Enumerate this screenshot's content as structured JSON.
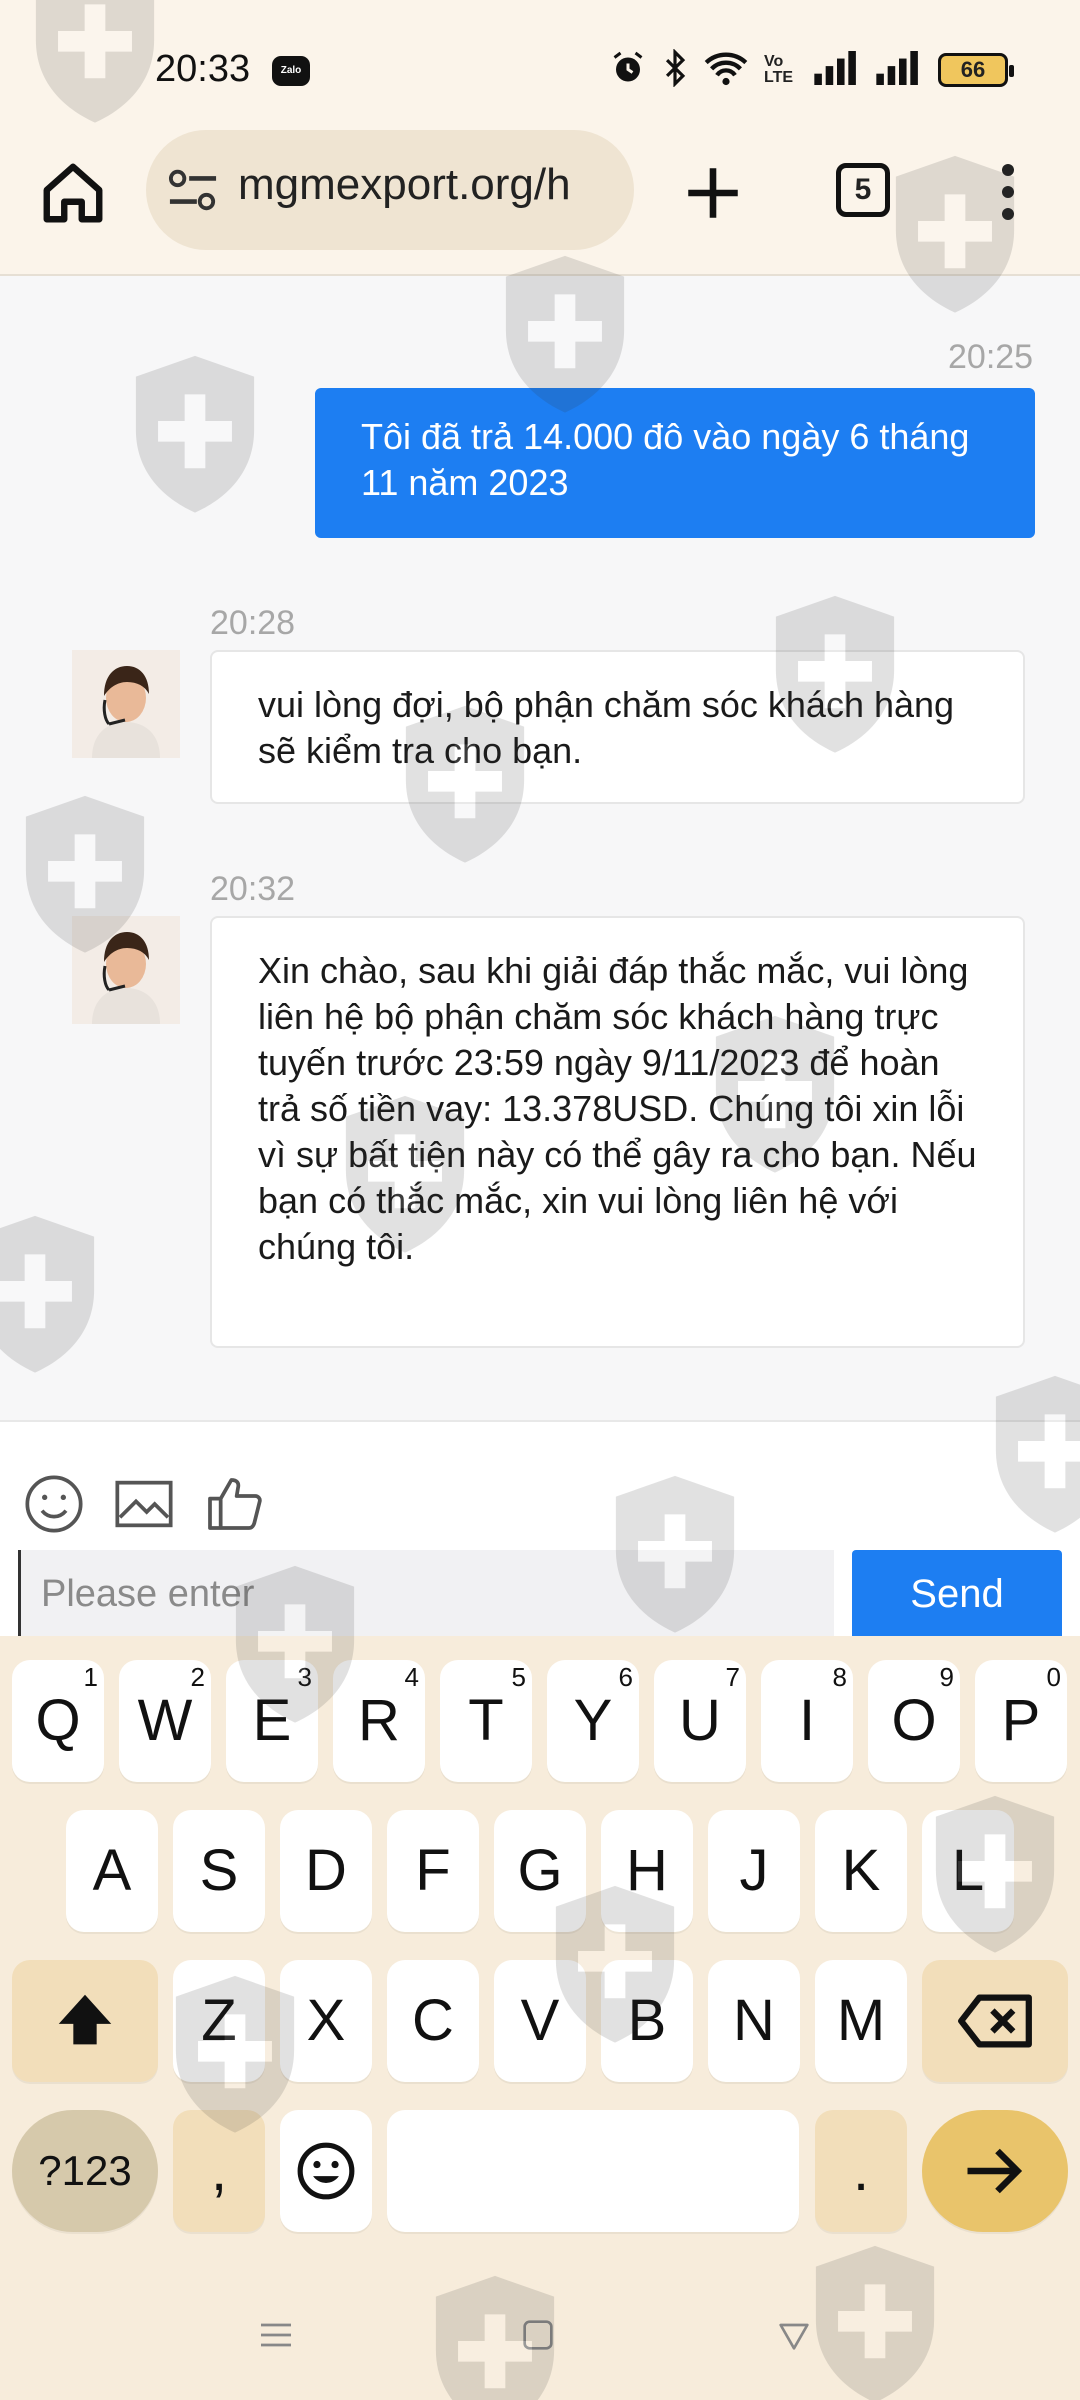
{
  "status_bar": {
    "time": "20:33",
    "notification_app": "Zalo",
    "battery": "66",
    "icons": [
      "alarm-icon",
      "bluetooth-icon",
      "wifi-icon",
      "volte-icon",
      "signal-icon",
      "signal-icon",
      "battery-icon"
    ]
  },
  "browser": {
    "url": "mgmexport.org/h",
    "tab_count": "5"
  },
  "chat": {
    "messages": [
      {
        "direction": "outgoing",
        "time": "20:25",
        "text": "Tôi đã trả 14.000 đô vào ngày 6 tháng 11 năm 2023"
      },
      {
        "direction": "incoming",
        "time": "20:28",
        "text": "vui lòng đợi, bộ phận chăm sóc khách hàng sẽ kiểm tra cho bạn."
      },
      {
        "direction": "incoming",
        "time": "20:32",
        "text": "Xin chào, sau khi giải đáp thắc mắc, vui lòng liên hệ bộ phận chăm sóc khách hàng trực tuyến trước 23:59 ngày 9/11/2023 để hoàn trả số tiền vay: 13.378USD. Chúng tôi xin lỗi vì sự bất tiện này có thể gây ra cho bạn. Nếu bạn có thắc mắc, xin vui lòng liên hệ với chúng tôi."
      }
    ]
  },
  "composer": {
    "placeholder": "Please enter",
    "send_label": "Send",
    "tools": [
      "emoji-icon",
      "image-icon",
      "thumbs-up-icon"
    ]
  },
  "keyboard": {
    "row1": [
      {
        "label": "Q",
        "sup": "1"
      },
      {
        "label": "W",
        "sup": "2"
      },
      {
        "label": "E",
        "sup": "3"
      },
      {
        "label": "R",
        "sup": "4"
      },
      {
        "label": "T",
        "sup": "5"
      },
      {
        "label": "Y",
        "sup": "6"
      },
      {
        "label": "U",
        "sup": "7"
      },
      {
        "label": "I",
        "sup": "8"
      },
      {
        "label": "O",
        "sup": "9"
      },
      {
        "label": "P",
        "sup": "0"
      }
    ],
    "row2": [
      "A",
      "S",
      "D",
      "F",
      "G",
      "H",
      "J",
      "K",
      "L"
    ],
    "row3": [
      "Z",
      "X",
      "C",
      "V",
      "B",
      "N",
      "M"
    ],
    "symbols_label": "?123",
    "comma_label": ",",
    "period_label": "."
  },
  "colors": {
    "accent_blue": "#1d7ef2",
    "chrome_beige": "#fbf4ea",
    "keyboard_bg": "#f7ecdb"
  }
}
